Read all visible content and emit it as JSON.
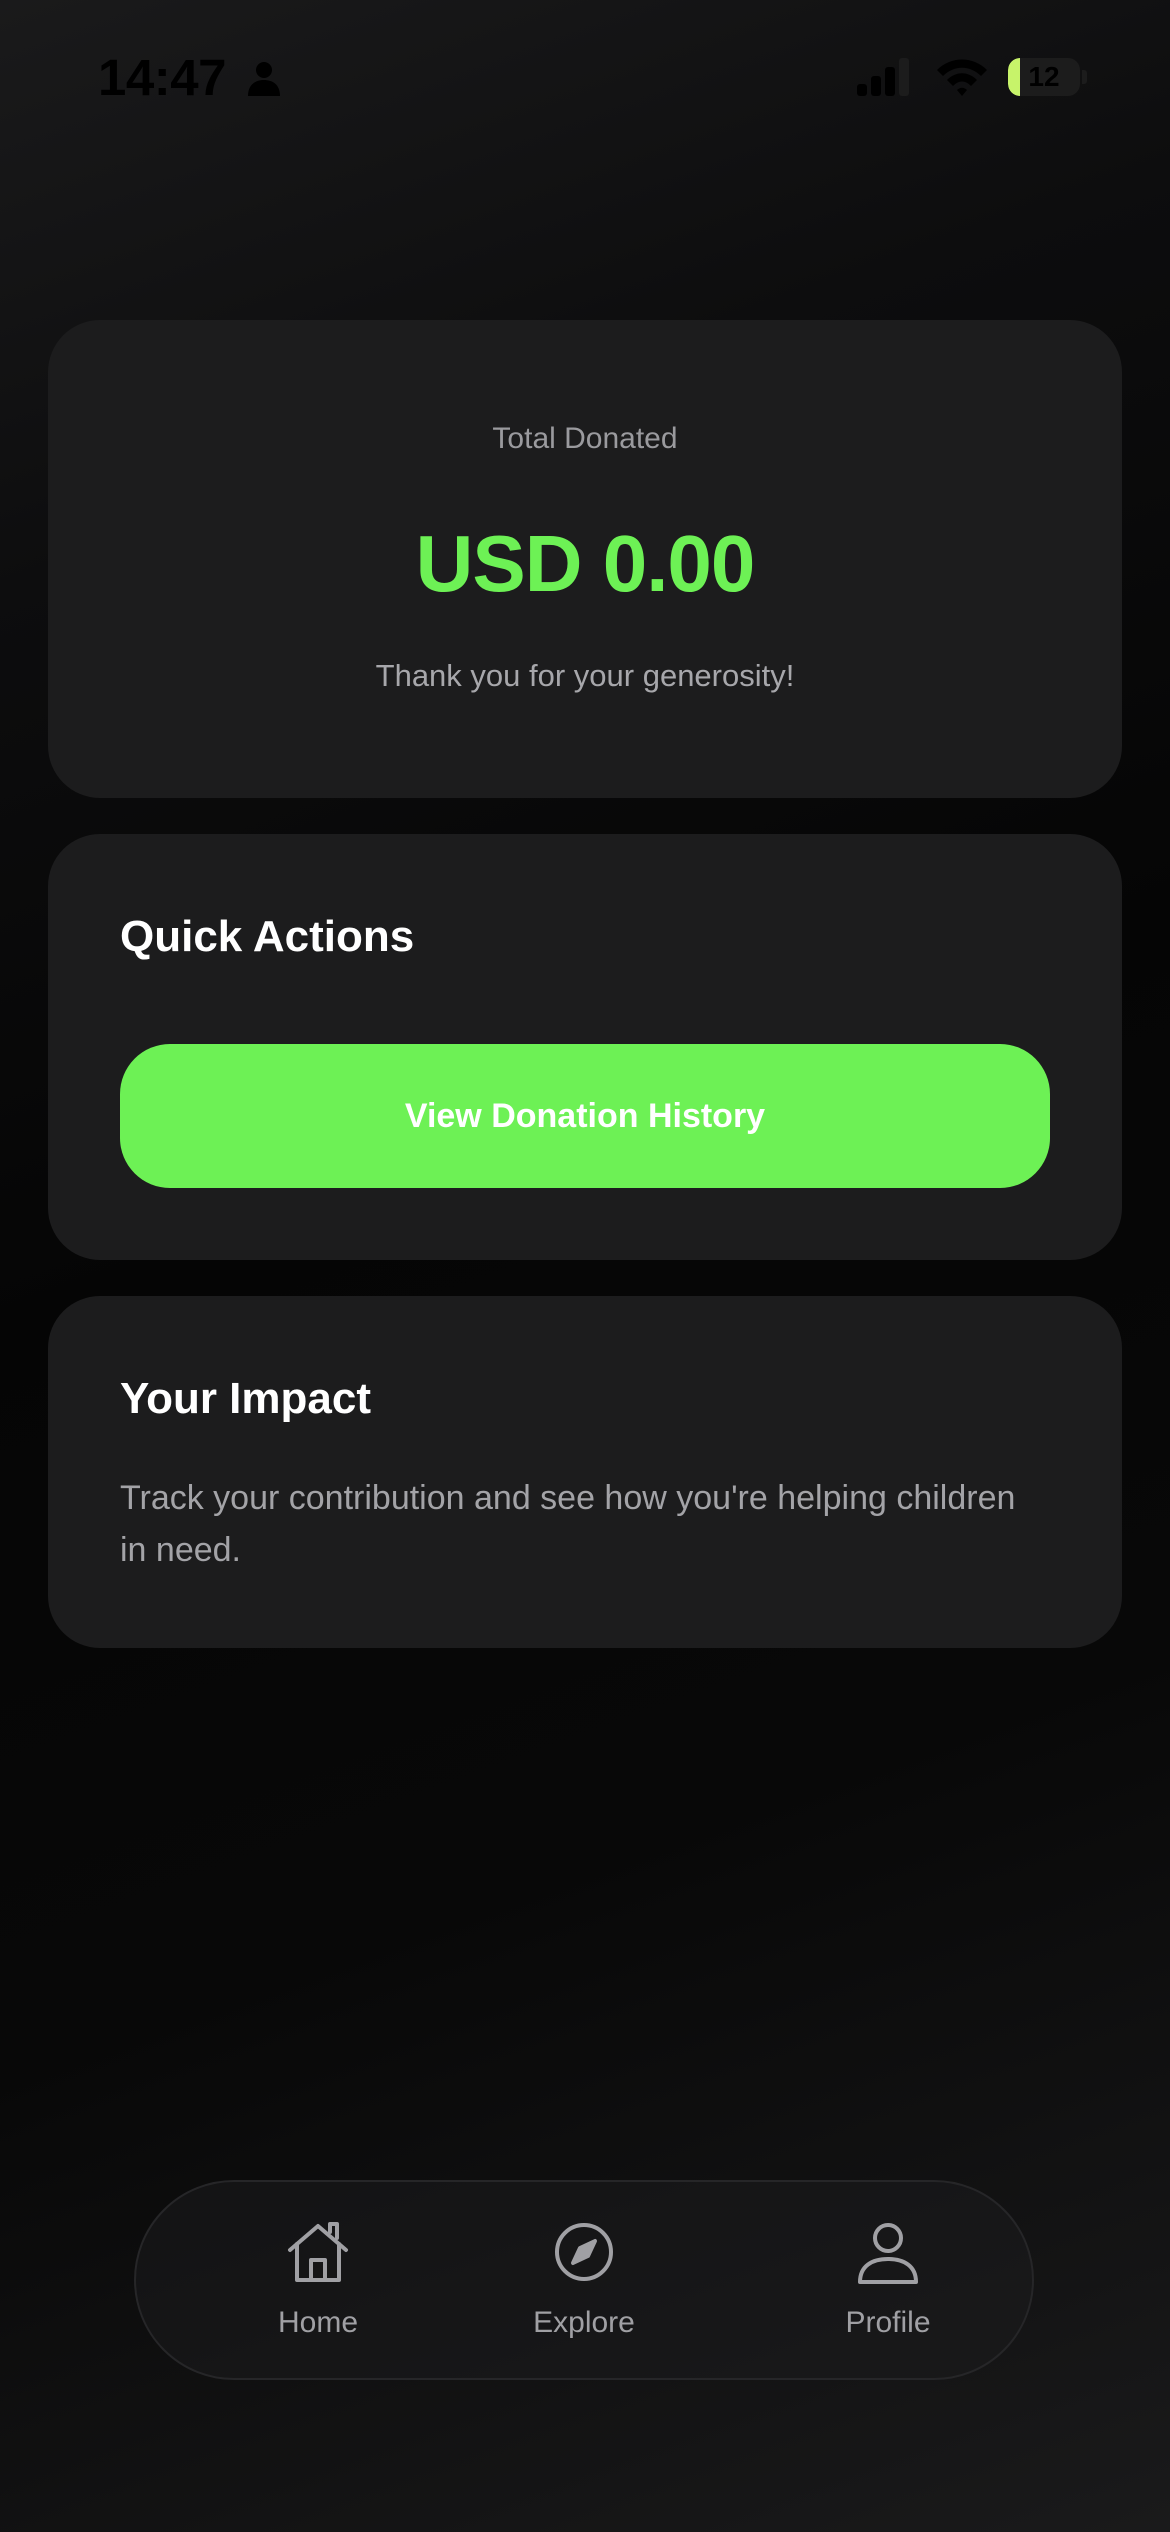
{
  "status_bar": {
    "time": "14:47",
    "battery_level": "12",
    "icons": [
      "person-icon",
      "signal-icon",
      "wifi-icon",
      "battery-icon"
    ],
    "battery_color": "#c7f36a"
  },
  "total_card": {
    "label": "Total Donated",
    "amount": "USD 0.00",
    "thanks": "Thank you for your generosity!"
  },
  "quick_actions": {
    "title": "Quick Actions",
    "history_button_label": "View Donation History"
  },
  "impact": {
    "title": "Your Impact",
    "text": "Track your contribution and see how you're helping children in need."
  },
  "bottom_nav": {
    "items": [
      {
        "label": "Home",
        "icon": "home-icon"
      },
      {
        "label": "Explore",
        "icon": "compass-icon"
      },
      {
        "label": "Profile",
        "icon": "user-icon"
      }
    ]
  },
  "colors": {
    "accent": "#6df155",
    "card_background": "#1c1c1d",
    "muted_text": "#a3a3a7"
  }
}
